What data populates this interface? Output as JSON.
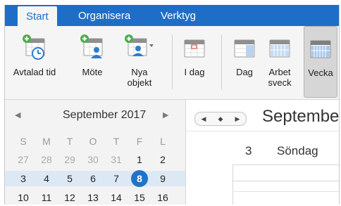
{
  "tabs": [
    {
      "label": "Start",
      "active": true
    },
    {
      "label": "Organisera",
      "active": false
    },
    {
      "label": "Verktyg",
      "active": false
    }
  ],
  "toolbar": {
    "appointment_label": "Avtalad tid",
    "meeting_label": "Möte",
    "new_items_label_line1": "Nya",
    "new_items_label_line2": "objekt",
    "today_label": "I dag",
    "day_label": "Dag",
    "workweek_label_line1": "Arbet",
    "workweek_label_line2": "sveck",
    "week_label": "Vecka"
  },
  "mini_calendar": {
    "title": "September 2017",
    "prev_glyph": "◀",
    "next_glyph": "▶",
    "weekday_headers": [
      "S",
      "M",
      "T",
      "O",
      "T",
      "F",
      "L"
    ],
    "weeks": [
      [
        {
          "d": "27",
          "outside": true
        },
        {
          "d": "28",
          "outside": true
        },
        {
          "d": "29",
          "outside": true
        },
        {
          "d": "30",
          "outside": true
        },
        {
          "d": "31",
          "outside": true
        },
        {
          "d": "1"
        },
        {
          "d": "2"
        }
      ],
      [
        {
          "d": "3"
        },
        {
          "d": "4"
        },
        {
          "d": "5"
        },
        {
          "d": "6"
        },
        {
          "d": "7"
        },
        {
          "d": "8",
          "today": true
        },
        {
          "d": "9"
        }
      ],
      [
        {
          "d": "10"
        },
        {
          "d": "11"
        },
        {
          "d": "12"
        },
        {
          "d": "13"
        },
        {
          "d": "14"
        },
        {
          "d": "15"
        },
        {
          "d": "16"
        }
      ]
    ],
    "highlighted_week_index": 1
  },
  "main_view": {
    "title": "September",
    "nav_prev": "◀",
    "nav_today": "◆",
    "nav_next": "▶",
    "day_number": "3",
    "day_name": "Söndag"
  },
  "colors": {
    "accent": "#1e6ec8",
    "today": "#1f74c8",
    "week_highlight": "#dde8f5",
    "ribbon_bg": "#f5f5f5",
    "icon_green": "#4caf50",
    "icon_blue": "#2f7bd0"
  },
  "icons": [
    "appointment-calendar-icon",
    "meeting-people-icon",
    "new-items-icon",
    "today-calendar-icon",
    "day-view-icon",
    "workweek-view-icon",
    "week-view-icon"
  ]
}
